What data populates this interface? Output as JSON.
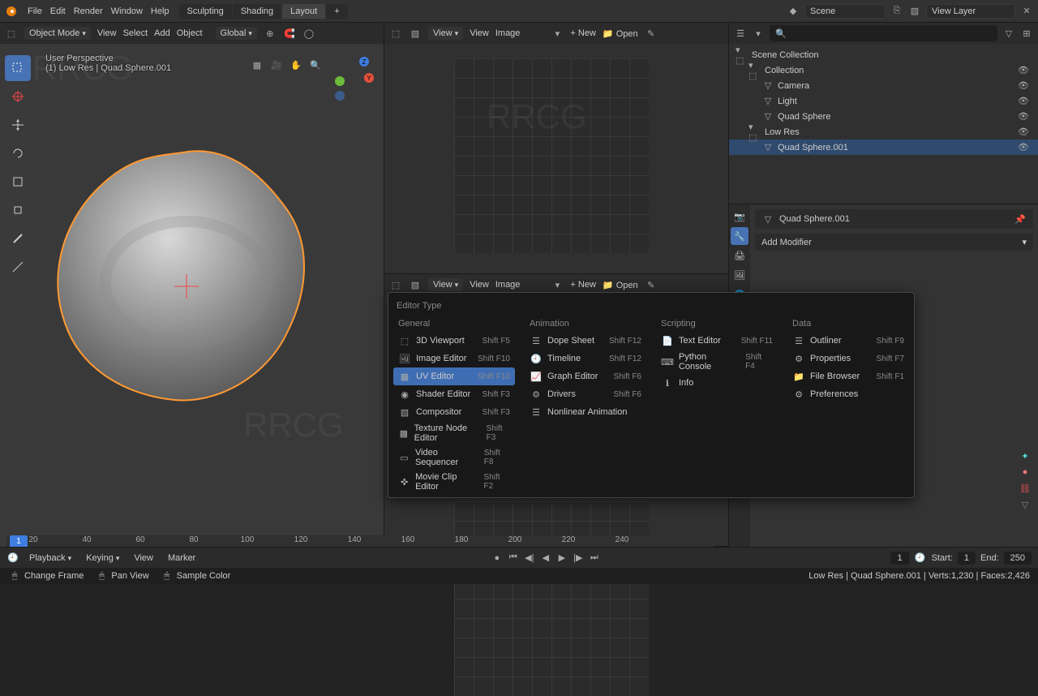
{
  "top_menu": [
    "File",
    "Edit",
    "Render",
    "Window",
    "Help"
  ],
  "workspace_tabs": [
    "Sculpting",
    "Shading",
    "Layout"
  ],
  "workspace_active": "Layout",
  "scene_field": "Scene",
  "viewlayer_field": "View Layer",
  "viewport": {
    "mode": "Object Mode",
    "dropdowns": [
      "View",
      "Select",
      "Add",
      "Object"
    ],
    "orientation": "Global",
    "persp": "User Perspective",
    "context": "(1) Low Res | Quad Sphere.001"
  },
  "uv": {
    "view_menu": "View",
    "menus": [
      "View",
      "Image"
    ],
    "new": "New",
    "open": "Open"
  },
  "outliner": {
    "root": "Scene Collection",
    "items": [
      {
        "depth": 1,
        "label": "Collection",
        "vis": true
      },
      {
        "depth": 2,
        "label": "Camera",
        "vis": true
      },
      {
        "depth": 2,
        "label": "Light",
        "vis": true
      },
      {
        "depth": 2,
        "label": "Quad Sphere",
        "vis": true
      },
      {
        "depth": 1,
        "label": "Low Res",
        "vis": true
      },
      {
        "depth": 2,
        "label": "Quad Sphere.001",
        "vis": true,
        "sel": true
      }
    ],
    "search_ph": ""
  },
  "props": {
    "object": "Quad Sphere.001",
    "add_modifier": "Add Modifier"
  },
  "timeline": {
    "playback": "Playback",
    "keying": "Keying",
    "view": "View",
    "marker": "Marker",
    "cur": "1",
    "start_label": "Start:",
    "start": "1",
    "end_label": "End:",
    "end": "250",
    "ticks": [
      "20",
      "40",
      "60",
      "80",
      "100",
      "120",
      "140",
      "160",
      "180",
      "200",
      "220",
      "240"
    ]
  },
  "status": {
    "left": [
      "Change Frame",
      "Pan View",
      "Sample Color"
    ],
    "right": "Low Res | Quad Sphere.001 | Verts:1,230 | Faces:2,426"
  },
  "editor_popup": {
    "title": "Editor Type",
    "columns": [
      {
        "header": "General",
        "items": [
          {
            "label": "3D Viewport",
            "sc": "Shift F5"
          },
          {
            "label": "Image Editor",
            "sc": "Shift F10"
          },
          {
            "label": "UV Editor",
            "sc": "Shift F10",
            "hl": true
          },
          {
            "label": "Shader Editor",
            "sc": "Shift F3"
          },
          {
            "label": "Compositor",
            "sc": "Shift F3"
          },
          {
            "label": "Texture Node Editor",
            "sc": "Shift F3"
          },
          {
            "label": "Video Sequencer",
            "sc": "Shift F8"
          },
          {
            "label": "Movie Clip Editor",
            "sc": "Shift F2"
          }
        ]
      },
      {
        "header": "Animation",
        "items": [
          {
            "label": "Dope Sheet",
            "sc": "Shift F12"
          },
          {
            "label": "Timeline",
            "sc": "Shift F12"
          },
          {
            "label": "Graph Editor",
            "sc": "Shift F6"
          },
          {
            "label": "Drivers",
            "sc": "Shift F6"
          },
          {
            "label": "Nonlinear Animation",
            "sc": ""
          }
        ]
      },
      {
        "header": "Scripting",
        "items": [
          {
            "label": "Text Editor",
            "sc": "Shift F11"
          },
          {
            "label": "Python Console",
            "sc": "Shift F4"
          },
          {
            "label": "Info",
            "sc": ""
          }
        ]
      },
      {
        "header": "Data",
        "items": [
          {
            "label": "Outliner",
            "sc": "Shift F9"
          },
          {
            "label": "Properties",
            "sc": "Shift F7"
          },
          {
            "label": "File Browser",
            "sc": "Shift F1"
          },
          {
            "label": "Preferences",
            "sc": ""
          }
        ]
      }
    ]
  }
}
